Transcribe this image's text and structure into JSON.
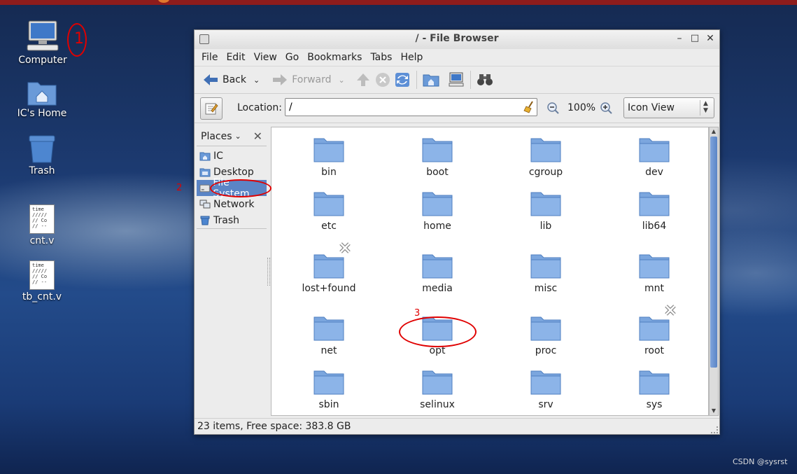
{
  "desktop": {
    "icons": [
      {
        "label": "Computer"
      },
      {
        "label": "IC's Home"
      },
      {
        "label": "Trash"
      },
      {
        "label": "cnt.v"
      },
      {
        "label": "tb_cnt.v"
      }
    ],
    "file_thumb_lines": [
      "time",
      "/////",
      "// Co",
      "// --"
    ]
  },
  "window": {
    "title": "/ - File Browser",
    "controls": {
      "minimize": "–",
      "maximize": "□",
      "close": "✕"
    }
  },
  "menubar": [
    "File",
    "Edit",
    "View",
    "Go",
    "Bookmarks",
    "Tabs",
    "Help"
  ],
  "toolbar": {
    "back": "Back",
    "forward": "Forward"
  },
  "location": {
    "label": "Location:",
    "value": "/",
    "zoom": "100%",
    "view_mode": "Icon View"
  },
  "sidebar": {
    "header": "Places",
    "items": [
      {
        "label": "IC",
        "icon": "home-folder-icon"
      },
      {
        "label": "Desktop",
        "icon": "desktop-folder-icon"
      },
      {
        "label": "File System",
        "icon": "drive-icon",
        "selected": true
      },
      {
        "label": "Network",
        "icon": "network-icon"
      },
      {
        "label": "Trash",
        "icon": "trash-icon"
      }
    ]
  },
  "folders": [
    {
      "name": "bin"
    },
    {
      "name": "boot"
    },
    {
      "name": "cgroup"
    },
    {
      "name": "dev"
    },
    {
      "name": "etc"
    },
    {
      "name": "home"
    },
    {
      "name": "lib"
    },
    {
      "name": "lib64"
    },
    {
      "name": "lost+found",
      "no_access": true
    },
    {
      "name": "media"
    },
    {
      "name": "misc"
    },
    {
      "name": "mnt"
    },
    {
      "name": "net"
    },
    {
      "name": "opt"
    },
    {
      "name": "proc"
    },
    {
      "name": "root",
      "no_access": true
    },
    {
      "name": "sbin"
    },
    {
      "name": "selinux"
    },
    {
      "name": "srv"
    },
    {
      "name": "sys"
    }
  ],
  "statusbar": "23 items, Free space: 383.8 GB",
  "annotations": {
    "n1": "1",
    "n2": "2",
    "n3": "3"
  },
  "watermark": "CSDN @sysrst",
  "colors": {
    "selection": "#5b85c6",
    "annotation": "#e00000",
    "folder": "#7ba6de"
  }
}
